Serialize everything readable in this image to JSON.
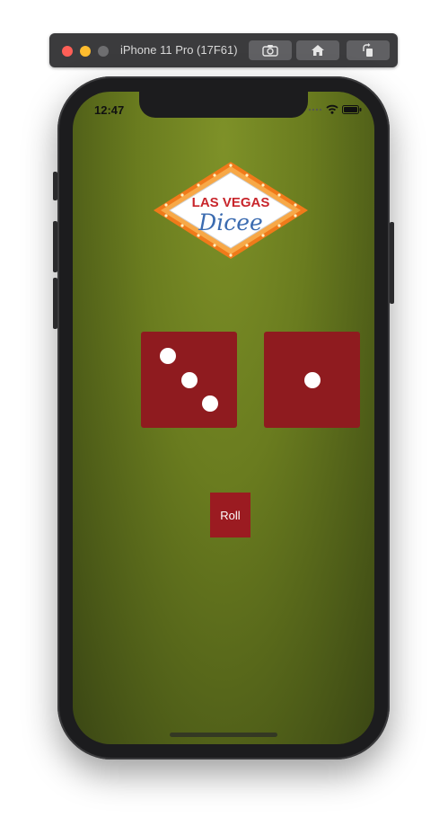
{
  "simulator": {
    "device_title": "iPhone 11 Pro (17F61)",
    "buttons": {
      "screenshot_icon": "camera-icon",
      "home_icon": "home-icon",
      "rotate_icon": "rotate-icon"
    }
  },
  "status_bar": {
    "time": "12:47",
    "icons": [
      "signal-dots-icon",
      "wifi-icon",
      "battery-icon"
    ]
  },
  "logo": {
    "line1": "LAS VEGAS",
    "line2": "Dicee"
  },
  "dice": [
    {
      "name": "left-die",
      "value": 3
    },
    {
      "name": "right-die",
      "value": 1
    }
  ],
  "roll_button": {
    "label": "Roll"
  },
  "colors": {
    "felt": "#6a7c1f",
    "die": "#8f1b1f",
    "button": "#9b1b21",
    "logo_red": "#c8252b",
    "logo_blue": "#3b6bb0",
    "logo_orange": "#f07a1a"
  }
}
